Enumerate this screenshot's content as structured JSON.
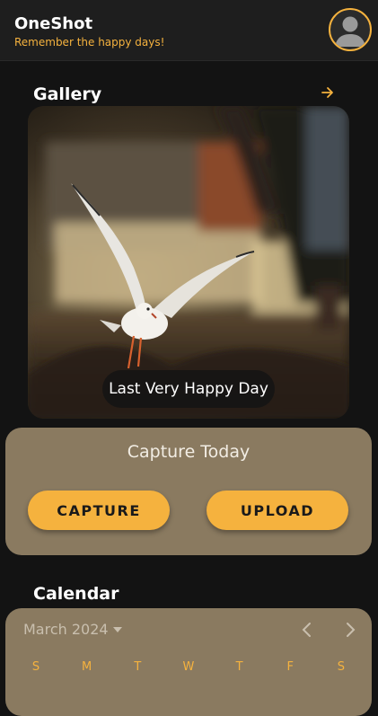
{
  "app": {
    "title": "OneShot",
    "subtitle": "Remember the happy days!"
  },
  "gallery": {
    "title": "Gallery",
    "caption": "Last Very Happy Day"
  },
  "capture": {
    "title": "Capture Today",
    "capture_label": "CAPTURE",
    "upload_label": "UPLOAD"
  },
  "calendar": {
    "title": "Calendar",
    "month": "March 2024",
    "weekdays": [
      "S",
      "M",
      "T",
      "W",
      "T",
      "F",
      "S"
    ]
  },
  "colors": {
    "accent": "#f5b23e",
    "card": "#8a7a60",
    "background": "#131313"
  },
  "icons": {
    "avatar": "account-circle-icon",
    "gallery_link": "arrow-right-icon",
    "month_dropdown": "caret-down-icon",
    "prev": "chevron-left-icon",
    "next": "chevron-right-icon"
  }
}
